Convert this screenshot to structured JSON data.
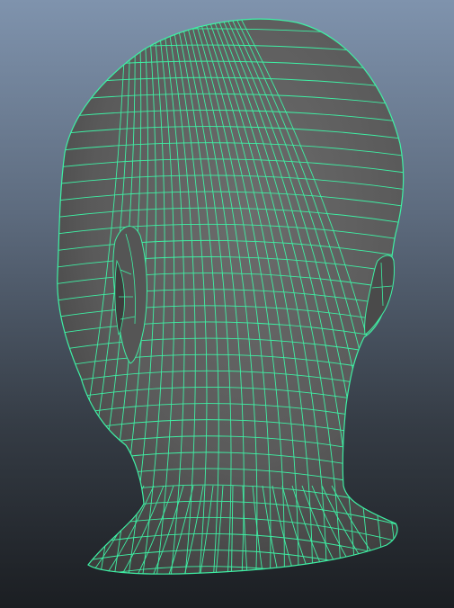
{
  "viewport": {
    "background_top": "#7f93ad",
    "background_bottom": "#1b1e22"
  },
  "mesh": {
    "shading_mid": "#5f5f5f",
    "shading_dark": "#3c3c3c",
    "shading_light": "#6c6c6c",
    "wireframe_color": "#3ef0a4"
  }
}
